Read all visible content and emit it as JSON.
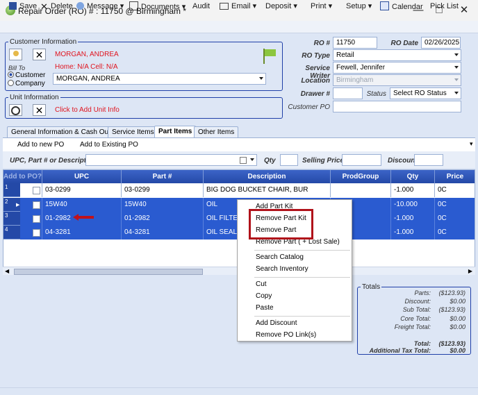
{
  "window": {
    "title": "Repair Order (RO) # : 11750 @ Birmingham *"
  },
  "toolbar": {
    "save": "Save",
    "delete": "Delete",
    "message": "Message",
    "documents": "Documents",
    "audit": "Audit",
    "email": "Email",
    "deposit": "Deposit",
    "print": "Print",
    "setup": "Setup",
    "calendar": "Calendar",
    "pick_list": "Pick List"
  },
  "customer": {
    "legend": "Customer Information",
    "name": "MORGAN, ANDREA",
    "phones": "Home: N/A Cell: N/A",
    "bill_to_label": "Bill To",
    "opt_customer": "Customer",
    "opt_company": "Company",
    "bill_to_value": "MORGAN, ANDREA"
  },
  "unit": {
    "legend": "Unit Information",
    "add_link": "Click to Add Unit Info"
  },
  "ro": {
    "num_label": "RO #",
    "num": "11750",
    "date_label": "RO Date",
    "date": "02/26/2025",
    "type_label": "RO Type",
    "type": "Retail",
    "writer_label": "Service Writer",
    "writer": "Fewell, Jennifer",
    "location_label": "Location",
    "location": "Birmingham",
    "drawer_label": "Drawer #",
    "drawer": "",
    "status_label": "Status",
    "status": "Select RO Status",
    "po_label": "Customer PO",
    "po": ""
  },
  "tabs": [
    "General Information & Cash Out",
    "Service Items",
    "Part Items",
    "Other Items"
  ],
  "subbar": {
    "add_new_po": "Add to new PO",
    "add_existing_po": "Add to Existing PO"
  },
  "search": {
    "upc_label": "UPC, Part # or Description",
    "qty_label": "Qty",
    "price_label": "Selling Price",
    "discount_label": "Discount"
  },
  "grid": {
    "headers": [
      "Add to PO?",
      "UPC",
      "Part #",
      "Description",
      "ProdGroup",
      "Qty",
      "Price Catego"
    ],
    "rows": [
      {
        "num": "1",
        "upc": "03-0299",
        "part": "03-0299",
        "desc": "BIG DOG BUCKET CHAIR, BUR",
        "prod": "",
        "qty": "-1.000",
        "price": "0C"
      },
      {
        "num": "2",
        "upc": "15W40",
        "part": "15W40",
        "desc": "OIL",
        "prod": "",
        "qty": "-10.000",
        "price": "0C"
      },
      {
        "num": "3",
        "upc": "01-2982",
        "part": "01-2982",
        "desc": "OIL FILTER",
        "prod": "",
        "qty": "-1.000",
        "price": "0C"
      },
      {
        "num": "4",
        "upc": "04-3281",
        "part": "04-3281",
        "desc": "OIL SEAL",
        "prod": "",
        "qty": "-1.000",
        "price": "0C"
      }
    ]
  },
  "context_menu": {
    "add_part_kit": "Add Part Kit",
    "remove_part_kit": "Remove Part Kit",
    "remove_part": "Remove Part",
    "remove_part_lost": "Remove Part ( + Lost Sale)",
    "search_catalog": "Search Catalog",
    "search_inventory": "Search Inventory",
    "cut": "Cut",
    "copy": "Copy",
    "paste": "Paste",
    "add_discount": "Add Discount",
    "remove_po_links": "Remove PO Link(s)"
  },
  "totals": {
    "legend": "Totals",
    "parts_label": "Parts:",
    "parts": "($123.93)",
    "discount_label": "Discount:",
    "discount": "$0.00",
    "subtotal_label": "Sub Total:",
    "subtotal": "($123.93)",
    "core_label": "Core Total:",
    "core": "$0.00",
    "freight_label": "Freight Total:",
    "freight": "$0.00",
    "total_label": "Total:",
    "total": "($123.93)",
    "addtax_label": "Additional Tax Total:",
    "addtax": "$0.00"
  },
  "colors": {
    "accent": "#2449a7",
    "selection": "#2a5bd0",
    "highlight_box": "#b0121a",
    "alert_text": "#e0141e"
  }
}
